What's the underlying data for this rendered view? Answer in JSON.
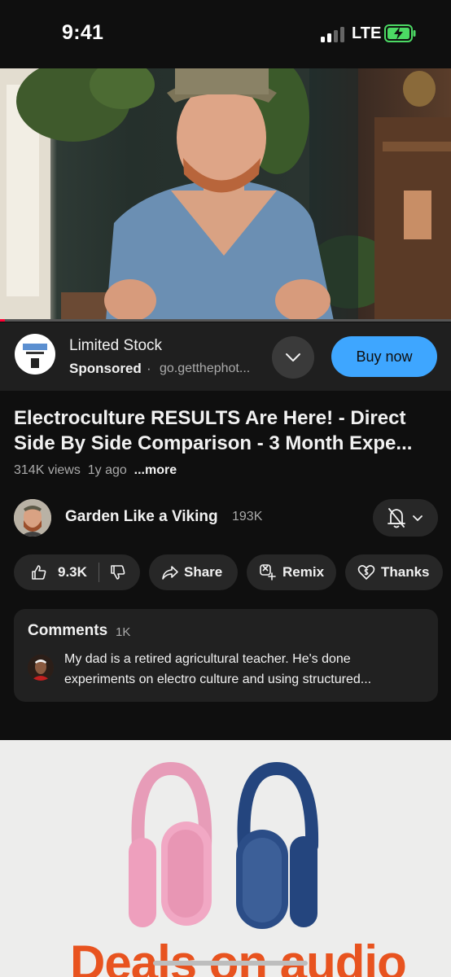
{
  "status_bar": {
    "time": "9:41",
    "network": "LTE",
    "battery_icon": "battery-charging-icon"
  },
  "video": {
    "progress_fraction": 0.01
  },
  "ad": {
    "title": "Limited Stock",
    "sponsored_label": "Sponsored",
    "separator": "·",
    "url": "go.getthephot...",
    "cta_label": "Buy now"
  },
  "details": {
    "title": "Electroculture RESULTS Are Here! - Direct Side By Side Comparison - 3 Month Expe...",
    "views": "314K views",
    "age": "1y ago",
    "more_label": "...more"
  },
  "channel": {
    "name": "Garden Like a Viking",
    "subscribers": "193K"
  },
  "actions": {
    "likes": "9.3K",
    "share": "Share",
    "remix": "Remix",
    "thanks": "Thanks"
  },
  "comments": {
    "title": "Comments",
    "count": "1K",
    "top_comment": "My dad is a retired agricultural teacher. He's done experiments on electro culture and using structured..."
  },
  "banner": {
    "headline": "Deals on audio"
  },
  "colors": {
    "accent_blue": "#3ea6ff",
    "progress_red": "#ff0033",
    "banner_orange": "#e8531f"
  }
}
